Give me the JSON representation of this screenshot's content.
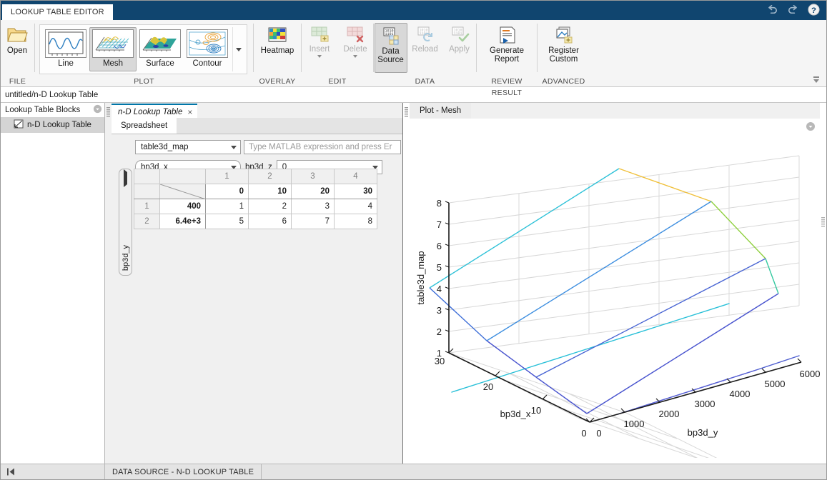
{
  "titlebar": {
    "app_tab": "LOOKUP TABLE EDITOR",
    "undo_icon": "undo-icon",
    "redo_icon": "redo-icon",
    "help_icon": "help-icon"
  },
  "ribbon": {
    "groups": [
      {
        "title": "FILE"
      },
      {
        "title": "PLOT"
      },
      {
        "title": "OVERLAY"
      },
      {
        "title": "EDIT"
      },
      {
        "title": "DATA"
      },
      {
        "title": "REVIEW RESULT"
      },
      {
        "title": "ADVANCED"
      }
    ],
    "open_label": "Open",
    "gallery": [
      {
        "label": "Line",
        "icon": "line-plot-icon",
        "selected": false
      },
      {
        "label": "Mesh",
        "icon": "mesh-plot-icon",
        "selected": true
      },
      {
        "label": "Surface",
        "icon": "surface-plot-icon",
        "selected": false
      },
      {
        "label": "Contour",
        "icon": "contour-plot-icon",
        "selected": false
      }
    ],
    "heatmap_label": "Heatmap",
    "insert_label": "Insert",
    "delete_label": "Delete",
    "data_source_label_1": "Data",
    "data_source_label_2": "Source",
    "reload_label": "Reload",
    "apply_label": "Apply",
    "generate_label_1": "Generate",
    "generate_label_2": "Report",
    "register_label_1": "Register",
    "register_label_2": "Custom"
  },
  "breadcrumb": {
    "path": "untitled/n-D Lookup Table"
  },
  "left_panel": {
    "header": "Lookup Table Blocks",
    "items": [
      {
        "label": "n-D Lookup Table",
        "icon": "lookup-table-icon"
      }
    ]
  },
  "center": {
    "doc_tab": "n-D Lookup Table",
    "doc_tab_close": "×",
    "sub_tab": "Spreadsheet",
    "table_select": "table3d_map",
    "expression_placeholder": "Type MATLAB expression and press Er",
    "expression_value": "",
    "breakpoint_select": "bp3d_x",
    "z_label": "bp3d_z",
    "z_value": "0",
    "vertical_axis_label": "bp3d_y",
    "spreadsheet": {
      "col_headers": [
        "1",
        "2",
        "3",
        "4"
      ],
      "col_values": [
        "0",
        "10",
        "20",
        "30"
      ],
      "row_headers": [
        "1",
        "2"
      ],
      "row_values": [
        "400",
        "6.4e+3"
      ],
      "cells": [
        [
          "1",
          "2",
          "3",
          "4"
        ],
        [
          "5",
          "6",
          "7",
          "8"
        ]
      ]
    }
  },
  "plot": {
    "tab_label": "Plot - Mesh"
  },
  "chart_data": {
    "type": "line",
    "title": "Plot - Mesh",
    "xlabel": "bp3d_x",
    "ylabel": "bp3d_y",
    "zlabel": "table3d_map",
    "x": [
      0,
      10,
      20,
      30
    ],
    "y": [
      400,
      6400
    ],
    "z": [
      [
        1,
        2,
        3,
        4
      ],
      [
        5,
        6,
        7,
        8
      ]
    ],
    "xticks": [
      0,
      10,
      20,
      30
    ],
    "yticks": [
      0,
      1000,
      2000,
      3000,
      4000,
      5000,
      6000
    ],
    "zticks": [
      1,
      2,
      3,
      4,
      5,
      6,
      7,
      8
    ],
    "xlim": [
      0,
      30
    ],
    "ylim": [
      0,
      6000
    ],
    "zlim": [
      1,
      8
    ],
    "grid": true,
    "legend": false,
    "colormap": "parula",
    "mesh_colors": [
      "#3b36c4",
      "#4350d8",
      "#3f7fe0",
      "#2fb3c9",
      "#1fc9bd",
      "#7fd14f",
      "#f0c03a",
      "#f5b731"
    ]
  },
  "statusbar": {
    "collapse_icon": "collapse-panel-icon",
    "label": "DATA SOURCE - N-D LOOKUP TABLE"
  },
  "colors": {
    "title_bar": "#10456f",
    "accent_tab": "#0076a8",
    "ribbon_bg": "#f5f5f5",
    "panel_bg": "#f0f0f0",
    "selection": "#d4d4d4"
  }
}
